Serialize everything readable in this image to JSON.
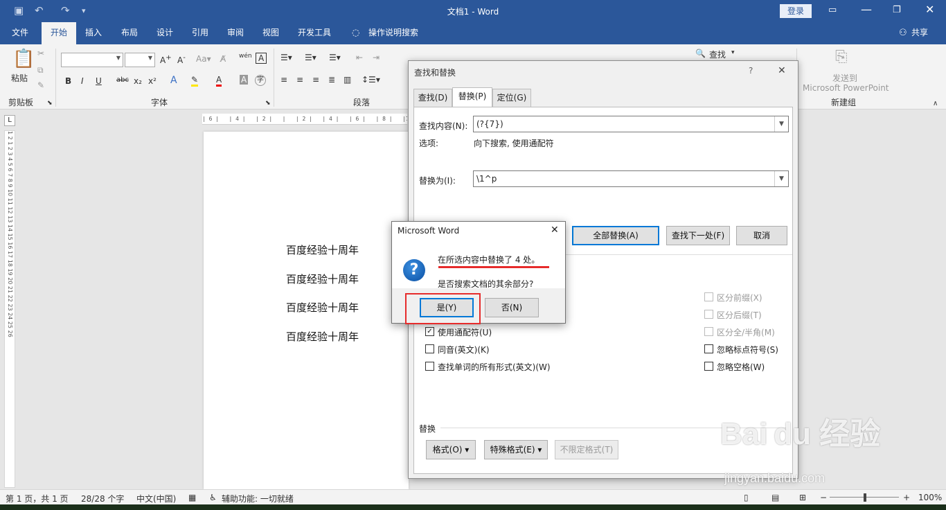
{
  "window": {
    "title": "文档1  -  Word",
    "login": "登录"
  },
  "ribbon_tabs": [
    "文件",
    "开始",
    "插入",
    "布局",
    "设计",
    "引用",
    "审阅",
    "视图",
    "开发工具",
    "操作说明搜索"
  ],
  "share": "共享",
  "ribbon": {
    "paste": "粘贴",
    "clipboard_group": "剪贴板",
    "font_group": "字体",
    "para_group": "段落",
    "find_button": "查找",
    "send_line1": "发送到",
    "send_line2": "Microsoft PowerPoint",
    "new_group": "新建组",
    "font_buttons": [
      "B",
      "I",
      "U",
      "abc",
      "x₂",
      "x²"
    ]
  },
  "ruler_text": "| 6 |   | 4 |   | 2 |   |   | 2 |   | 4 |   | 6 |   | 8 |   |10|",
  "vruler_text": "1 2 1 2 3 4 5 6 7 8 9 10 11 12 13 14 15 16 17 18 19 20 21 22 23 24 25 26",
  "document": {
    "lines": [
      "百度经验十周年",
      "百度经验十周年",
      "百度经验十周年",
      "百度经验十周年"
    ]
  },
  "find_dialog": {
    "title": "查找和替换",
    "help": "?",
    "close": "✕",
    "tabs": [
      "查找(D)",
      "替换(P)",
      "定位(G)"
    ],
    "find_label": "查找内容(N):",
    "find_value": "(?{7})",
    "options_label": "选项:",
    "options_value": "向下搜索, 使用通配符",
    "replace_label": "替换为(I):",
    "replace_value": "\\1^p",
    "buttons": {
      "replace_all": "全部替换(A)",
      "find_next": "查找下一处(F)",
      "cancel": "取消"
    },
    "left_checks": [
      {
        "label": "使用通配符(U)",
        "checked": true
      },
      {
        "label": "同音(英文)(K)",
        "checked": false
      },
      {
        "label": "查找单词的所有形式(英文)(W)",
        "checked": false
      }
    ],
    "right_checks": [
      {
        "label": "区分前缀(X)",
        "disabled": true
      },
      {
        "label": "区分后缀(T)",
        "disabled": true
      },
      {
        "label": "区分全/半角(M)",
        "disabled": true
      },
      {
        "label": "忽略标点符号(S)",
        "disabled": false
      },
      {
        "label": "忽略空格(W)",
        "disabled": false
      }
    ],
    "replace_section": "替换",
    "format_button": "格式(O)",
    "special_button": "特殊格式(E)",
    "no_format_button": "不限定格式(T)"
  },
  "message_box": {
    "title": "Microsoft Word",
    "line1": "在所选内容中替换了 4 处。",
    "line2": "是否搜索文档的其余部分?",
    "yes": "是(Y)",
    "no": "否(N)",
    "close": "✕"
  },
  "status": {
    "page": "第 1 页，共 1 页",
    "words": "28/28 个字",
    "lang": "中文(中国)",
    "access": "辅助功能: 一切就绪",
    "zoom": "100%"
  },
  "watermark": {
    "brand": "Bai du 经验",
    "url": "jingyan.baidu.com"
  }
}
